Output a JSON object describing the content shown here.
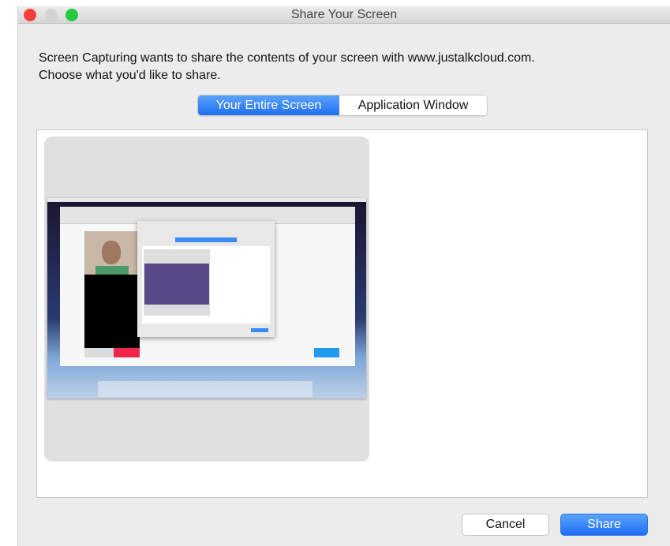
{
  "window": {
    "title": "Share Your Screen"
  },
  "message": {
    "line1": "Screen Capturing wants to share the contents of your screen with www.justalkcloud.com.",
    "line2": "Choose what you'd like to share."
  },
  "tabs": [
    {
      "label": "Your Entire Screen",
      "selected": true
    },
    {
      "label": "Application Window",
      "selected": false
    }
  ],
  "buttons": {
    "cancel": "Cancel",
    "share": "Share"
  },
  "colors": {
    "accent": "#1f6ef5",
    "close": "#fc3d39",
    "zoom": "#27c93f"
  }
}
